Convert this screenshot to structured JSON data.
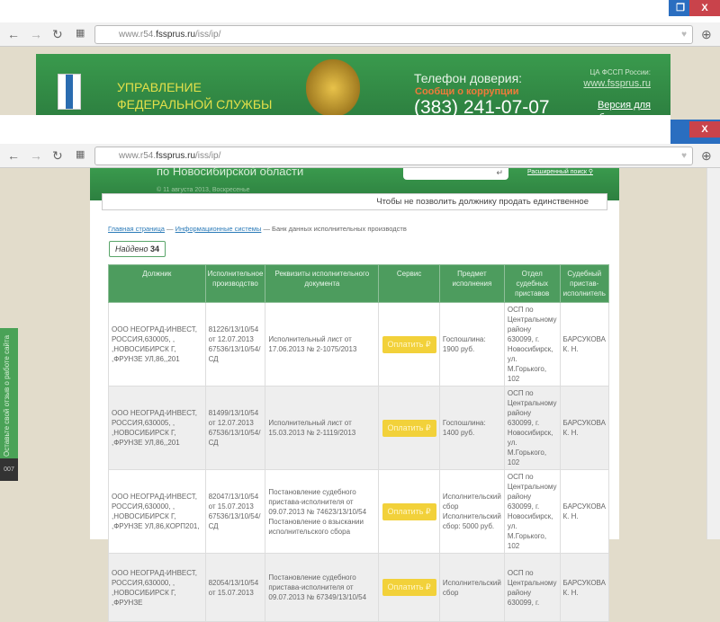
{
  "browser": {
    "url_prefix": "www.r54.",
    "url_domain": "fssprus.ru",
    "url_path": "/iss/ip/",
    "restore": "❐",
    "close": "X"
  },
  "header": {
    "org_title": "УПРАВЛЕНИЕ ФЕДЕРАЛЬНОЙ СЛУЖБЫ СУДЕБНЫХ ПРИСТАВОВ",
    "region": "по Новосибирской области",
    "date": "© 11 августа 2013, Воскресенье",
    "phone_label": "Телефон доверия:",
    "corruption_link": "Сообщи о коррупции",
    "phone": "(383) 241-07-07",
    "central_label": "ЦА ФССП России:",
    "central_link": "www.fssprus.ru",
    "vision_link": "Версия для слабовидящих",
    "advanced_search": "Расширенный поиск"
  },
  "ticker": "Чтобы не позволить должнику продать единственное",
  "breadcrumb": [
    "Главная страница",
    "Информационные системы",
    "Банк данных исполнительных производств"
  ],
  "found_label": "Найдено",
  "found_count": "34",
  "feedback": "Оставьте свой отзыв о работе сайта",
  "table": {
    "headers": [
      "Должник",
      "Исполнительное производство",
      "Реквизиты исполнительного документа",
      "Сервис",
      "Предмет исполнения",
      "Отдел судебных приставов",
      "Судебный пристав-исполнитель"
    ],
    "pay_label": "Оплатить ₽",
    "rows": [
      {
        "debtor": "ООО НЕОГРАД-ИНВЕСТ, РОССИЯ,630005, , ,НОВОСИБИРСК Г, ,ФРУНЗЕ УЛ,86,,201",
        "proceeding": "81226/13/10/54 от 12.07.2013 67536/13/10/54/СД",
        "document": "Исполнительный лист от 17.06.2013 № 2-1075/2013",
        "subject": "Госпошлина: 1900 руб.",
        "department": "ОСП по Центральному району 630099, г. Новосибирск, ул. М.Горького, 102",
        "bailiff": "БАРСУКОВА К. Н."
      },
      {
        "debtor": "ООО НЕОГРАД-ИНВЕСТ, РОССИЯ,630005, , ,НОВОСИБИРСК Г, ,ФРУНЗЕ УЛ,86,,201",
        "proceeding": "81499/13/10/54 от 12.07.2013 67536/13/10/54/СД",
        "document": "Исполнительный лист от 15.03.2013 № 2-1119/2013",
        "subject": "Госпошлина: 1400 руб.",
        "department": "ОСП по Центральному району 630099, г. Новосибирск, ул. М.Горького, 102",
        "bailiff": "БАРСУКОВА К. Н."
      },
      {
        "debtor": "ООО НЕОГРАД-ИНВЕСТ, РОССИЯ,630000, , ,НОВОСИБИРСК Г, ,ФРУНЗЕ УЛ,86,КОРП201,",
        "proceeding": "82047/13/10/54 от 15.07.2013 67536/13/10/54/СД",
        "document": "Постановление судебного пристава-исполнителя от 09.07.2013 № 74623/13/10/54 Постановление о взыскании исполнительского сбора",
        "subject": "Исполнительский сбор Исполнительский сбор: 5000 руб.",
        "department": "ОСП по Центральному району 630099, г. Новосибирск, ул. М.Горького, 102",
        "bailiff": "БАРСУКОВА К. Н."
      },
      {
        "debtor": "ООО НЕОГРАД-ИНВЕСТ, РОССИЯ,630000, , ,НОВОСИБИРСК Г, ,ФРУНЗЕ",
        "proceeding": "82054/13/10/54 от 15.07.2013",
        "document": "Постановление судебного пристава-исполнителя от 09.07.2013 № 67349/13/10/54",
        "subject": "Исполнительский сбор",
        "department": "ОСП по Центральному району 630099, г.",
        "bailiff": "БАРСУКОВА К. Н."
      }
    ]
  }
}
